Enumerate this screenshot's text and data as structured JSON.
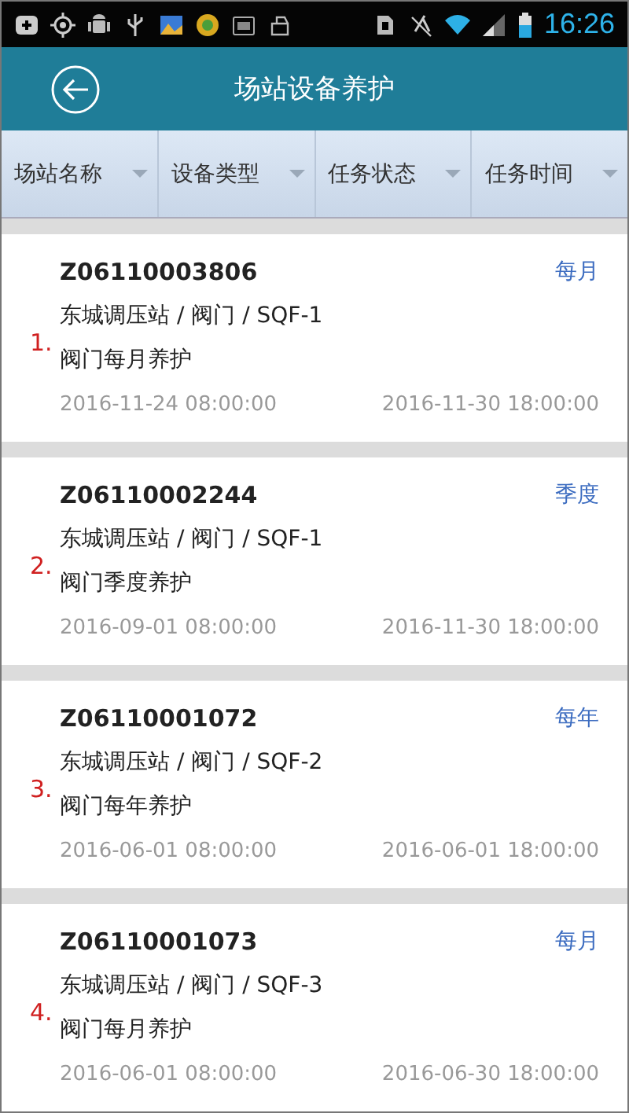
{
  "status_bar": {
    "time": "16:26"
  },
  "header": {
    "title": "场站设备养护"
  },
  "filters": [
    {
      "label": "场站名称"
    },
    {
      "label": "设备类型"
    },
    {
      "label": "任务状态"
    },
    {
      "label": "任务时间"
    }
  ],
  "tasks": [
    {
      "index": "1.",
      "code": "Z06110003806",
      "cycle": "每月",
      "path": "东城调压站 / 阀门 / SQF-1",
      "name": "阀门每月养护",
      "start": "2016-11-24 08:00:00",
      "end": "2016-11-30 18:00:00"
    },
    {
      "index": "2.",
      "code": "Z06110002244",
      "cycle": "季度",
      "path": "东城调压站 / 阀门 / SQF-1",
      "name": "阀门季度养护",
      "start": "2016-09-01 08:00:00",
      "end": "2016-11-30 18:00:00"
    },
    {
      "index": "3.",
      "code": "Z06110001072",
      "cycle": "每年",
      "path": "东城调压站 / 阀门 / SQF-2",
      "name": "阀门每年养护",
      "start": "2016-06-01 08:00:00",
      "end": "2016-06-01 18:00:00"
    },
    {
      "index": "4.",
      "code": "Z06110001073",
      "cycle": "每月",
      "path": "东城调压站 / 阀门 / SQF-3",
      "name": "阀门每月养护",
      "start": "2016-06-01 08:00:00",
      "end": "2016-06-30 18:00:00"
    }
  ]
}
